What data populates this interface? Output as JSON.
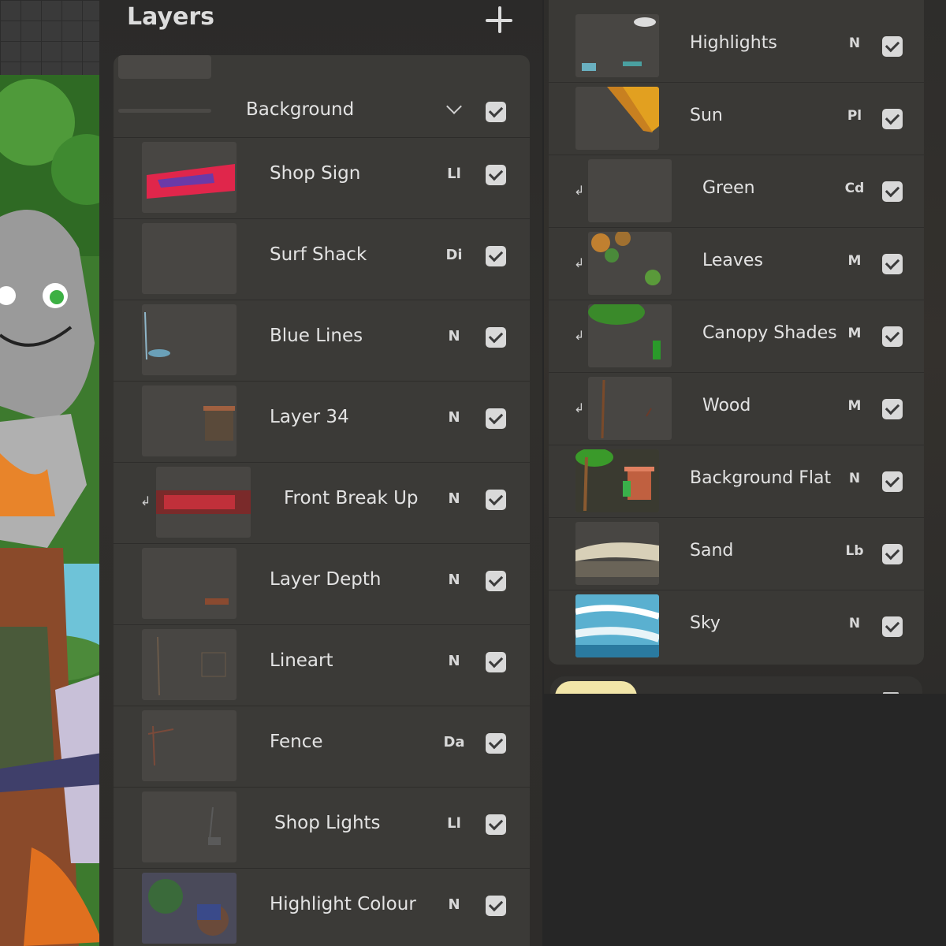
{
  "panel_left": {
    "title": "Layers",
    "group": {
      "label": "Background"
    },
    "layers": [
      {
        "name": "Shop Sign",
        "mode": "Ll",
        "clipped": false
      },
      {
        "name": "Surf Shack",
        "mode": "Di",
        "clipped": false
      },
      {
        "name": "Blue Lines",
        "mode": "N",
        "clipped": false
      },
      {
        "name": "Layer 34",
        "mode": "N",
        "clipped": false
      },
      {
        "name": "Front Break Up",
        "mode": "N",
        "clipped": true
      },
      {
        "name": "Layer Depth",
        "mode": "N",
        "clipped": false
      },
      {
        "name": "Lineart",
        "mode": "N",
        "clipped": false
      },
      {
        "name": "Fence",
        "mode": "Da",
        "clipped": false
      },
      {
        "name": "Shop Lights",
        "mode": "Ll",
        "clipped": false
      },
      {
        "name": "Highlight Colour",
        "mode": "N",
        "clipped": false
      }
    ]
  },
  "panel_right": {
    "layers": [
      {
        "name": "Highlights",
        "mode": "N",
        "clipped": false
      },
      {
        "name": "Sun",
        "mode": "Pl",
        "clipped": false
      },
      {
        "name": "Green",
        "mode": "Cd",
        "clipped": true
      },
      {
        "name": "Leaves",
        "mode": "M",
        "clipped": true
      },
      {
        "name": "Canopy Shades",
        "mode": "M",
        "clipped": true
      },
      {
        "name": "Wood",
        "mode": "M",
        "clipped": true
      },
      {
        "name": "Background Flat",
        "mode": "N",
        "clipped": false
      },
      {
        "name": "Sand",
        "mode": "Lb",
        "clipped": false
      },
      {
        "name": "Sky",
        "mode": "N",
        "clipped": false
      }
    ]
  },
  "icons": {
    "add": "plus-icon",
    "checkbox": "checkbox-checked-icon",
    "clip": "clipping-mask-icon",
    "expand": "chevron-down-icon"
  },
  "colors": {
    "panel_bg": "#3b3a37",
    "checkbox": "#d9d9d9",
    "text": "#e3e3e3"
  }
}
